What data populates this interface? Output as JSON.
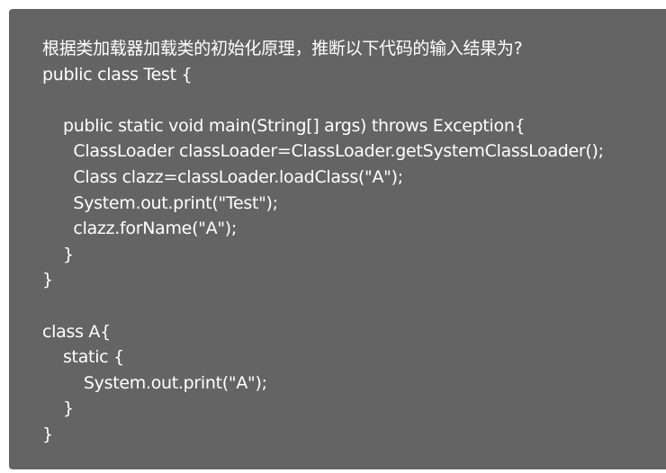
{
  "question": {
    "prompt": "根据类加载器加载类的初始化原理，推断以下代码的输入结果为?",
    "code_lines": [
      "public class Test {",
      "",
      "    public static void main(String[] args) throws Exception{",
      "      ClassLoader classLoader=ClassLoader.getSystemClassLoader();",
      "      Class clazz=classLoader.loadClass(\"A\");",
      "      System.out.print(\"Test\");",
      "      clazz.forName(\"A\");",
      "    }",
      "}",
      "",
      "class A{",
      "    static {",
      "        System.out.print(\"A\");",
      "    }",
      "}"
    ]
  }
}
